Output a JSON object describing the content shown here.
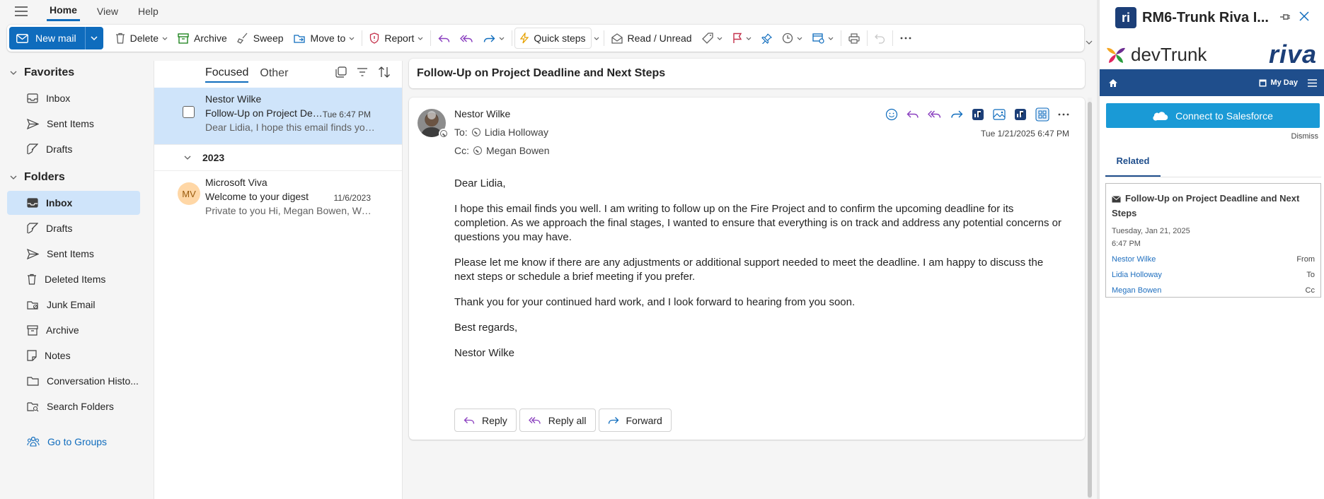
{
  "tabs": [
    {
      "label": "Home",
      "active": true
    },
    {
      "label": "View",
      "active": false
    },
    {
      "label": "Help",
      "active": false
    }
  ],
  "ribbon": {
    "new_mail": "New mail",
    "delete": "Delete",
    "archive": "Archive",
    "sweep": "Sweep",
    "move_to": "Move to",
    "report": "Report",
    "quick_steps": "Quick steps",
    "read_unread": "Read / Unread"
  },
  "nav": {
    "favorites_label": "Favorites",
    "favorites": [
      {
        "label": "Inbox",
        "icon": "inbox-icon"
      },
      {
        "label": "Sent Items",
        "icon": "sent-icon"
      },
      {
        "label": "Drafts",
        "icon": "drafts-icon"
      }
    ],
    "folders_label": "Folders",
    "folders": [
      {
        "label": "Inbox",
        "icon": "inbox-icon",
        "selected": true
      },
      {
        "label": "Drafts",
        "icon": "drafts-icon"
      },
      {
        "label": "Sent Items",
        "icon": "sent-icon"
      },
      {
        "label": "Deleted Items",
        "icon": "trash-icon"
      },
      {
        "label": "Junk Email",
        "icon": "junk-icon"
      },
      {
        "label": "Archive",
        "icon": "archive-icon"
      },
      {
        "label": "Notes",
        "icon": "notes-icon"
      },
      {
        "label": "Conversation Histo...",
        "icon": "folder-icon"
      },
      {
        "label": "Search Folders",
        "icon": "search-folder-icon"
      }
    ],
    "groups_link": "Go to Groups"
  },
  "list": {
    "tab_focused": "Focused",
    "tab_other": "Other",
    "messages": [
      {
        "from": "Nestor Wilke",
        "subject": "Follow-Up on Project Deadline and Next Steps",
        "time": "Tue 6:47 PM",
        "preview": "Dear Lidia, I hope this email finds you well. I am writing to follow up on the Fire Project"
      }
    ],
    "group_label": "2023",
    "group_messages": [
      {
        "initials": "MV",
        "from": "Microsoft Viva",
        "subject": "Welcome to your digest",
        "time": "11/6/2023",
        "preview": "Private to you Hi, Megan Bowen, Welcome to your new digest"
      }
    ]
  },
  "reading": {
    "subject": "Follow-Up on Project Deadline and Next Steps",
    "sender": "Nestor Wilke",
    "to_label": "To:",
    "to": "Lidia Holloway",
    "cc_label": "Cc:",
    "cc": "Megan Bowen",
    "date": "Tue 1/21/2025 6:47 PM",
    "body": [
      "Dear Lidia,",
      "I hope this email finds you well. I am writing to follow up on the Fire Project and to confirm the upcoming deadline for its completion. As we approach the final stages, I wanted to ensure that everything is on track and address any potential concerns or questions you may have.",
      "Please let me know if there are any adjustments or additional support needed to meet the deadline. I am happy to discuss the next steps or schedule a brief meeting if you prefer.",
      "Thank you for your continued hard work, and I look forward to hearing from you soon.",
      "Best regards,",
      "Nestor Wilke"
    ],
    "reply": "Reply",
    "reply_all": "Reply all",
    "forward": "Forward"
  },
  "riva": {
    "title": "RM6-Trunk Riva I...",
    "devtrunk": "devTrunk",
    "brand": "riva",
    "my_day": "My Day",
    "connect": "Connect to Salesforce",
    "dismiss": "Dismiss",
    "related_tab": "Related",
    "card_subject": "Follow-Up on Project Deadline and Next Steps",
    "card_date": "Tuesday, Jan 21, 2025",
    "card_time": "6:47 PM",
    "people": [
      {
        "name": "Nestor Wilke",
        "role": "From"
      },
      {
        "name": "Lidia Holloway",
        "role": "To"
      },
      {
        "name": "Megan Bowen",
        "role": "Cc"
      }
    ]
  },
  "colors": {
    "accent": "#0f6cbd",
    "selection": "#cfe4fa",
    "riva_navy": "#1f4e8c",
    "salesforce": "#1a9ad6"
  }
}
